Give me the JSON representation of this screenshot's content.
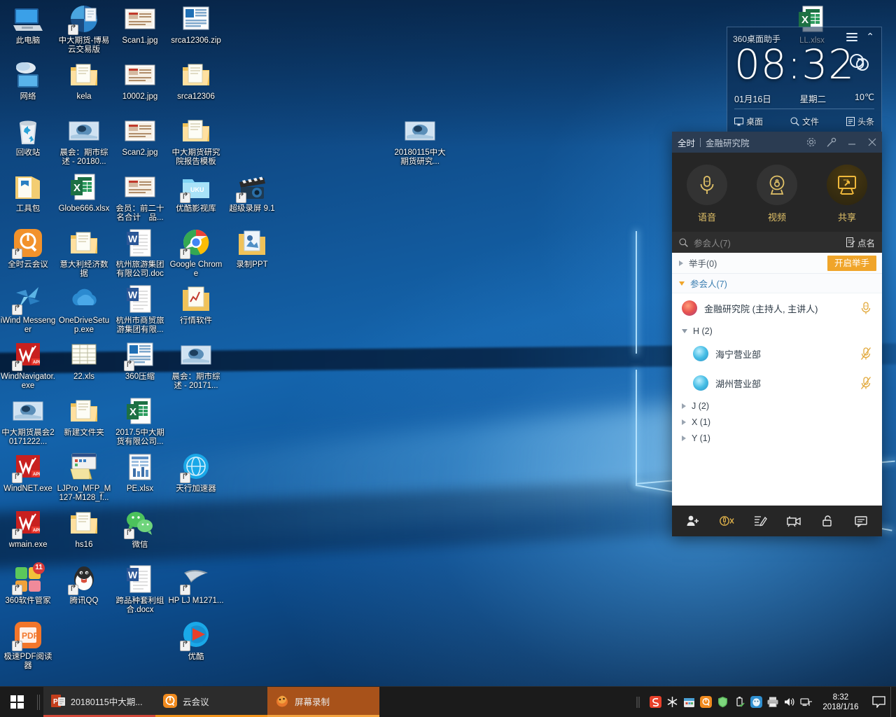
{
  "desktop": {
    "icons": [
      {
        "label": "此电脑",
        "type": "computer",
        "col": 0,
        "row": 0
      },
      {
        "label": "中大期货-博易云交易版",
        "type": "app-blue-pie",
        "col": 1,
        "row": 0,
        "shortcut": true
      },
      {
        "label": "Scan1.jpg",
        "type": "image-card",
        "col": 2,
        "row": 0
      },
      {
        "label": "srca12306.zip",
        "type": "zip-blue",
        "col": 3,
        "row": 0
      },
      {
        "label": "网络",
        "type": "network",
        "col": 0,
        "row": 1
      },
      {
        "label": "kela",
        "type": "folder-round",
        "col": 1,
        "row": 1
      },
      {
        "label": "10002.jpg",
        "type": "image-card",
        "col": 2,
        "row": 1
      },
      {
        "label": "srca12306",
        "type": "folder-open",
        "col": 3,
        "row": 1
      },
      {
        "label": "回收站",
        "type": "recycle",
        "col": 0,
        "row": 2
      },
      {
        "label": "晨会：期市综述 - 20180...",
        "type": "image-wide",
        "col": 1,
        "row": 2
      },
      {
        "label": "Scan2.jpg",
        "type": "image-card",
        "col": 2,
        "row": 2
      },
      {
        "label": "中大期货研究院报告模板",
        "type": "folder-open",
        "col": 3,
        "row": 2
      },
      {
        "label": "工具包",
        "type": "folder-blue",
        "col": 0,
        "row": 3
      },
      {
        "label": "Globe666.xlsx",
        "type": "excel",
        "col": 1,
        "row": 3
      },
      {
        "label": "会员：前二十名合计　品...",
        "type": "image-card",
        "col": 2,
        "row": 3
      },
      {
        "label": "优酷影视库",
        "type": "youku-folder",
        "col": 3,
        "row": 3,
        "shortcut": true
      },
      {
        "label": "超级录屏 9.1",
        "type": "clapper",
        "col": 4,
        "row": 3,
        "shortcut": true
      },
      {
        "label": "全时云会议",
        "type": "quanshi",
        "col": 0,
        "row": 4,
        "shortcut": true
      },
      {
        "label": "意大利经济数据",
        "type": "folder-round",
        "col": 1,
        "row": 4
      },
      {
        "label": "杭州旅游集团有限公司.doc",
        "type": "word",
        "col": 2,
        "row": 4
      },
      {
        "label": "Google Chrome",
        "type": "chrome",
        "col": 3,
        "row": 4,
        "shortcut": true
      },
      {
        "label": "录制PPT",
        "type": "folder-ppt",
        "col": 4,
        "row": 4
      },
      {
        "label": "iWind Messenger",
        "type": "iwind",
        "col": 0,
        "row": 5,
        "shortcut": true
      },
      {
        "label": "OneDriveSetup.exe",
        "type": "onedrive",
        "col": 1,
        "row": 5
      },
      {
        "label": "杭州市商贸旅游集团有限...",
        "type": "word",
        "col": 2,
        "row": 5
      },
      {
        "label": "行情软件",
        "type": "folder-hq",
        "col": 3,
        "row": 5
      },
      {
        "label": "WindNavigator.exe",
        "type": "wind-red",
        "col": 0,
        "row": 6,
        "shortcut": true
      },
      {
        "label": "22.xls",
        "type": "xls-old",
        "col": 1,
        "row": 6
      },
      {
        "label": "360压缩",
        "type": "zip-blue",
        "col": 2,
        "row": 6,
        "shortcut": true
      },
      {
        "label": "晨会：期市综述 - 20171...",
        "type": "image-wide",
        "col": 3,
        "row": 6
      },
      {
        "label": "中大期货晨会20171222...",
        "type": "image-wide",
        "col": 0,
        "row": 7
      },
      {
        "label": "新建文件夹",
        "type": "folder-round",
        "col": 1,
        "row": 7
      },
      {
        "label": "2017.5中大期货有限公司...",
        "type": "excel",
        "col": 2,
        "row": 7
      },
      {
        "label": "WindNET.exe",
        "type": "wind-red",
        "col": 0,
        "row": 8,
        "shortcut": true
      },
      {
        "label": "LJPro_MFP_M127-M128_f...",
        "type": "installer",
        "col": 1,
        "row": 8
      },
      {
        "label": "PE.xlsx",
        "type": "sheet-plain",
        "col": 2,
        "row": 8
      },
      {
        "label": "天行加速器",
        "type": "globe-blue",
        "col": 3,
        "row": 8,
        "shortcut": true
      },
      {
        "label": "wmain.exe",
        "type": "wind-red",
        "col": 0,
        "row": 9,
        "shortcut": true
      },
      {
        "label": "hs16",
        "type": "folder-round",
        "col": 1,
        "row": 9
      },
      {
        "label": "微信",
        "type": "wechat",
        "col": 2,
        "row": 9,
        "shortcut": true
      },
      {
        "label": "360软件管家",
        "type": "soft360",
        "col": 0,
        "row": 10,
        "shortcut": true,
        "badge": "11"
      },
      {
        "label": "腾讯QQ",
        "type": "qq",
        "col": 1,
        "row": 10,
        "shortcut": true
      },
      {
        "label": "跨品种套利组合.docx",
        "type": "word",
        "col": 2,
        "row": 10
      },
      {
        "label": "HP LJ M1271...",
        "type": "hp-printer",
        "col": 3,
        "row": 10,
        "shortcut": true
      },
      {
        "label": "极速PDF阅读器",
        "type": "pdf",
        "col": 0,
        "row": 11,
        "shortcut": true
      },
      {
        "label": "优酷",
        "type": "youku",
        "col": 3,
        "row": 11,
        "shortcut": true
      },
      {
        "label": "20180115中大期货研究...",
        "type": "image-wide",
        "col": 7,
        "row": 2
      },
      {
        "label": "LL.xlsx",
        "type": "excel",
        "col": 14,
        "row": 0
      }
    ]
  },
  "widget360": {
    "title": "360桌面助手",
    "time": "08:32",
    "date": "01月16日",
    "weekday": "星期二",
    "temperature": "10℃",
    "weather_icon": "cloud-icon",
    "menu_icon": "hamburger-icon",
    "collapse_icon": "chevron-up-icon",
    "links": [
      {
        "label": "桌面",
        "icon": "monitor-icon"
      },
      {
        "label": "文件",
        "icon": "search-icon"
      },
      {
        "label": "头条",
        "icon": "news-icon"
      }
    ]
  },
  "meeting": {
    "brand": "全时",
    "name": "金融研究院",
    "window_controls": [
      {
        "name": "settings-icon",
        "glyph": "gear"
      },
      {
        "name": "tools-icon",
        "glyph": "wrench"
      },
      {
        "name": "minimize-icon",
        "glyph": "minus"
      },
      {
        "name": "close-icon",
        "glyph": "x"
      }
    ],
    "actions": [
      {
        "label": "语音",
        "icon": "microphone-icon",
        "active": false
      },
      {
        "label": "视频",
        "icon": "camera-icon",
        "active": false
      },
      {
        "label": "共享",
        "icon": "screen-share-icon",
        "active": true
      }
    ],
    "search_placeholder": "参会人(7)",
    "rollcall_label": "点名",
    "raise_hand_label": "举手(0)",
    "raise_hand_button": "开启举手",
    "participants_header": "参会人(7)",
    "host": {
      "name": "金融研究院 (主持人, 主讲人)",
      "mic": "mic-on-icon"
    },
    "groups": [
      {
        "label": "H (2)",
        "expanded": true,
        "members": [
          {
            "name": "海宁营业部",
            "mic": "mic-muted-icon"
          },
          {
            "name": "湖州营业部",
            "mic": "mic-muted-icon"
          }
        ]
      },
      {
        "label": "J (2)",
        "expanded": false,
        "members": []
      },
      {
        "label": "X (1)",
        "expanded": false,
        "members": []
      },
      {
        "label": "Y (1)",
        "expanded": false,
        "members": []
      }
    ],
    "toolbar": [
      {
        "name": "invite-user-icon"
      },
      {
        "name": "mute-all-icon"
      },
      {
        "name": "annotate-icon"
      },
      {
        "name": "record-icon"
      },
      {
        "name": "lock-meeting-icon"
      },
      {
        "name": "chat-icon"
      }
    ],
    "colors": {
      "accent": "#e2c268",
      "button": "#f0a52a",
      "titlebar": "#2b3c52",
      "panel_dark": "#262626"
    }
  },
  "taskbar": {
    "start_icon": "windows-logo-icon",
    "items": [
      {
        "label": "20180115中大期...",
        "icon": "powerpoint-icon",
        "state": "active-ppt"
      },
      {
        "label": "云会议",
        "icon": "quanshi-icon",
        "state": "active-meet"
      },
      {
        "label": "屏幕录制",
        "icon": "recorder-icon",
        "state": "active-rec"
      }
    ],
    "tray": [
      {
        "name": "sogou-input-icon"
      },
      {
        "name": "snowflake-icon"
      },
      {
        "name": "calendar-icon"
      },
      {
        "name": "quanshi-tray-icon"
      },
      {
        "name": "shield-icon"
      },
      {
        "name": "usb-eject-icon"
      },
      {
        "name": "tencent-tray-icon"
      },
      {
        "name": "printer-icon"
      },
      {
        "name": "volume-icon"
      },
      {
        "name": "network-icon"
      }
    ],
    "clock_time": "8:32",
    "clock_date": "2018/1/16",
    "action_center_icon": "notification-icon"
  }
}
